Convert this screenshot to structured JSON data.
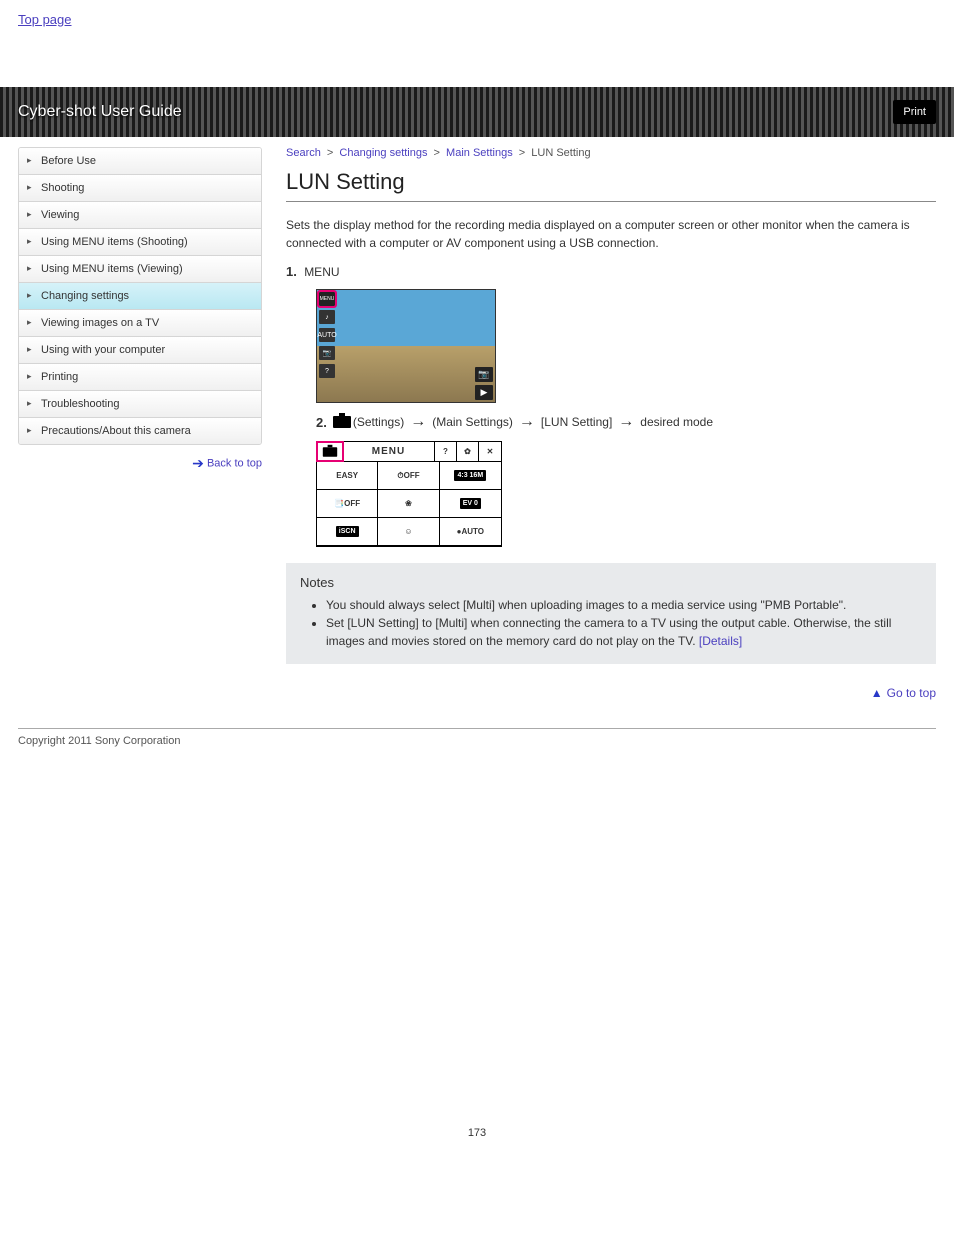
{
  "top_link": "Top page",
  "banner": {
    "title": "Cyber-shot User Guide",
    "print_label": "Print"
  },
  "sidebar": {
    "items": [
      {
        "label": "Before Use"
      },
      {
        "label": "Shooting"
      },
      {
        "label": "Viewing"
      },
      {
        "label": "Using MENU items (Shooting)"
      },
      {
        "label": "Using MENU items (Viewing)"
      },
      {
        "label": "Changing settings",
        "active": true
      },
      {
        "label": "Viewing images on a TV"
      },
      {
        "label": "Using with your computer"
      },
      {
        "label": "Printing"
      },
      {
        "label": "Troubleshooting"
      },
      {
        "label": "Precautions/About this camera"
      }
    ],
    "back": "Back to top"
  },
  "breadcrumb": {
    "a": "Search",
    "b": "Changing settings",
    "c": "Main Settings",
    "d": "LUN Setting"
  },
  "page_title": "LUN Setting",
  "intro": "Sets the display method for the recording media displayed on a computer screen or other monitor when the camera is connected with a computer or AV component using a USB connection.",
  "steps": {
    "s1": {
      "num": "1.",
      "text": "MENU",
      "hl_color": "#e60073"
    },
    "s2": {
      "num": "2.",
      "path_a": "(Settings)",
      "path_b": "(Main Settings)",
      "path_c": "[LUN Setting]",
      "path_d": "desired mode"
    }
  },
  "screenshot1": {
    "left_icons": [
      "MENU",
      "♪",
      "AUTO",
      "📷",
      "?"
    ],
    "right_icons": [
      "📷",
      "▶"
    ]
  },
  "screenshot2": {
    "header": {
      "settings": "⚙",
      "menu": "MENU",
      "help": "?",
      "gear": "✿",
      "close": "✕"
    },
    "grid": [
      "EASY",
      "⏱OFF",
      "4:3 16M",
      "📑OFF",
      "❀",
      "EV 0",
      "iSCN",
      "☺",
      "●AUTO"
    ]
  },
  "notes": {
    "title": "Notes",
    "items": [
      "You should always select [Multi] when uploading images to a media service using \"PMB Portable\".",
      {
        "prefix": "Set [LUN Setting] to [Multi] when connecting the camera to a TV using the output cable. Otherwise, the still images and movies stored on the memory card do not play on the TV. ",
        "link_text": "[Details]"
      }
    ]
  },
  "go_top": "Go to top",
  "copyright": "Copyright 2011 Sony Corporation",
  "page_number": "173"
}
